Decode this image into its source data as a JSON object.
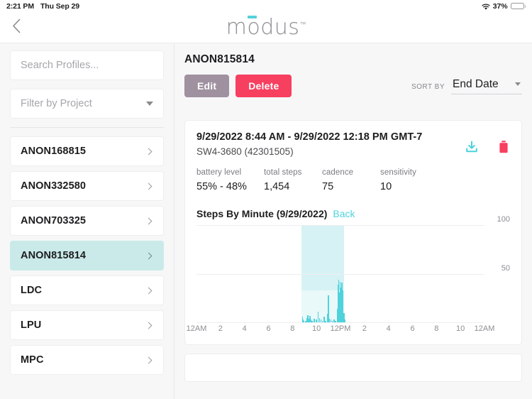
{
  "status_bar": {
    "time": "2:21 PM",
    "date": "Thu Sep 29",
    "wifi_icon": "wifi-icon",
    "battery_percent": "37%",
    "battery_level": 37,
    "battery_color": "#f5c542"
  },
  "header": {
    "back_icon": "chevron-left-icon",
    "brand": "mdus",
    "brand_prefix": "m",
    "brand_suffix": "dus",
    "brand_o": "o",
    "trademark": "™",
    "macron_color": "#56d0d8"
  },
  "sidebar": {
    "search_placeholder": "Search Profiles...",
    "filter_label": "Filter by Project",
    "profiles": [
      {
        "name": "ANON168815",
        "selected": false
      },
      {
        "name": "ANON332580",
        "selected": false
      },
      {
        "name": "ANON703325",
        "selected": false
      },
      {
        "name": "ANON815814",
        "selected": true
      },
      {
        "name": "LDC",
        "selected": false
      },
      {
        "name": "LPU",
        "selected": false
      },
      {
        "name": "MPC",
        "selected": false
      }
    ],
    "selected_bg": "#c9eae9"
  },
  "main": {
    "page_title": "ANON815814",
    "edit_label": "Edit",
    "delete_label": "Delete",
    "edit_color": "#9f91a0",
    "delete_color": "#f73f60",
    "sort_label": "SORT BY",
    "sort_value": "End Date"
  },
  "session_card": {
    "date_range": "9/29/2022 8:44 AM - 9/29/2022 12:18 PM GMT-7",
    "device_id": "SW4-3680 (42301505)",
    "download_icon": "download-icon",
    "download_icon_color": "#4fd2dc",
    "delete_icon": "trash-icon",
    "delete_icon_color": "#f73f60",
    "metrics": [
      {
        "label": "battery level",
        "value": "55% - 48%"
      },
      {
        "label": "total steps",
        "value": "1,454"
      },
      {
        "label": "cadence",
        "value": "75"
      },
      {
        "label": "sensitivity",
        "value": "10"
      }
    ],
    "chart_title": "Steps By Minute (9/29/2022)",
    "back_link": "Back"
  },
  "chart_data": {
    "type": "bar",
    "title": "Steps By Minute (9/29/2022)",
    "xlabel": "",
    "ylabel": "",
    "ylim": [
      0,
      100
    ],
    "yticks": [
      50,
      100
    ],
    "grid": true,
    "legend": false,
    "bar_color": "#4fd2dc",
    "highlight_band": {
      "start_hour": 8.733,
      "end_hour": 12.3,
      "color": "#d6f2f4",
      "lower_color": "#e9f8f9",
      "lower_top_fraction": 0.33
    },
    "xticks": [
      {
        "label": "12AM",
        "hour": 0
      },
      {
        "label": "2",
        "hour": 2
      },
      {
        "label": "4",
        "hour": 4
      },
      {
        "label": "6",
        "hour": 6
      },
      {
        "label": "8",
        "hour": 8
      },
      {
        "label": "10",
        "hour": 10
      },
      {
        "label": "12PM",
        "hour": 12
      },
      {
        "label": "2",
        "hour": 14
      },
      {
        "label": "4",
        "hour": 16
      },
      {
        "label": "6",
        "hour": 18
      },
      {
        "label": "8",
        "hour": 20
      },
      {
        "label": "10",
        "hour": 22
      },
      {
        "label": "12AM",
        "hour": 24
      }
    ],
    "x_range_hours": [
      0,
      24
    ],
    "points": [
      {
        "hour": 8.78,
        "value": 6
      },
      {
        "hour": 8.83,
        "value": 3
      },
      {
        "hour": 8.9,
        "value": 2
      },
      {
        "hour": 9.05,
        "value": 2
      },
      {
        "hour": 9.18,
        "value": 5
      },
      {
        "hour": 9.25,
        "value": 8
      },
      {
        "hour": 9.32,
        "value": 4
      },
      {
        "hour": 9.4,
        "value": 7
      },
      {
        "hour": 9.48,
        "value": 3
      },
      {
        "hour": 9.6,
        "value": 2
      },
      {
        "hour": 9.75,
        "value": 4
      },
      {
        "hour": 9.95,
        "value": 3
      },
      {
        "hour": 10.1,
        "value": 11
      },
      {
        "hour": 10.2,
        "value": 5
      },
      {
        "hour": 10.32,
        "value": 3
      },
      {
        "hour": 10.45,
        "value": 2
      },
      {
        "hour": 10.6,
        "value": 6
      },
      {
        "hour": 10.72,
        "value": 2
      },
      {
        "hour": 10.85,
        "value": 9
      },
      {
        "hour": 10.95,
        "value": 28
      },
      {
        "hour": 11.02,
        "value": 4
      },
      {
        "hour": 11.15,
        "value": 3
      },
      {
        "hour": 11.28,
        "value": 2
      },
      {
        "hour": 11.42,
        "value": 3
      },
      {
        "hour": 11.55,
        "value": 2
      },
      {
        "hour": 11.68,
        "value": 14
      },
      {
        "hour": 11.74,
        "value": 39
      },
      {
        "hour": 11.8,
        "value": 44
      },
      {
        "hour": 11.86,
        "value": 31
      },
      {
        "hour": 11.92,
        "value": 42
      },
      {
        "hour": 11.97,
        "value": 20
      },
      {
        "hour": 12.02,
        "value": 36
      },
      {
        "hour": 12.07,
        "value": 41
      },
      {
        "hour": 12.12,
        "value": 33
      },
      {
        "hour": 12.17,
        "value": 12
      },
      {
        "hour": 12.22,
        "value": 6
      },
      {
        "hour": 12.26,
        "value": 10
      },
      {
        "hour": 12.3,
        "value": 3
      }
    ]
  }
}
